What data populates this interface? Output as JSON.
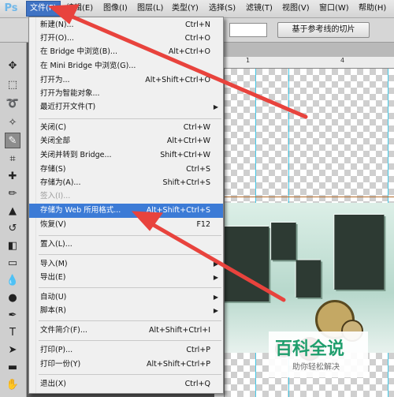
{
  "app": {
    "logo": "Ps"
  },
  "menubar": {
    "items": [
      {
        "label": "文件(F)"
      },
      {
        "label": "编辑(E)"
      },
      {
        "label": "图像(I)"
      },
      {
        "label": "图层(L)"
      },
      {
        "label": "类型(Y)"
      },
      {
        "label": "选择(S)"
      },
      {
        "label": "滤镜(T)"
      },
      {
        "label": "视图(V)"
      },
      {
        "label": "窗口(W)"
      },
      {
        "label": "帮助(H)"
      }
    ]
  },
  "options_bar": {
    "slice_button": "基于参考线的切片"
  },
  "ruler": {
    "ticks": [
      "1",
      "4"
    ]
  },
  "file_menu": {
    "items": [
      {
        "label": "新建(N)...",
        "shortcut": "Ctrl+N"
      },
      {
        "label": "打开(O)...",
        "shortcut": "Ctrl+O"
      },
      {
        "label": "在 Bridge 中浏览(B)...",
        "shortcut": "Alt+Ctrl+O"
      },
      {
        "label": "在 Mini Bridge 中浏览(G)...",
        "shortcut": ""
      },
      {
        "label": "打开为...",
        "shortcut": "Alt+Shift+Ctrl+O"
      },
      {
        "label": "打开为智能对象...",
        "shortcut": ""
      },
      {
        "label": "最近打开文件(T)",
        "shortcut": ""
      },
      {
        "label": "关闭(C)",
        "shortcut": "Ctrl+W"
      },
      {
        "label": "关闭全部",
        "shortcut": "Alt+Ctrl+W"
      },
      {
        "label": "关闭并转到 Bridge...",
        "shortcut": "Shift+Ctrl+W"
      },
      {
        "label": "存储(S)",
        "shortcut": "Ctrl+S"
      },
      {
        "label": "存储为(A)...",
        "shortcut": "Shift+Ctrl+S"
      },
      {
        "label": "签入(I)...",
        "shortcut": ""
      },
      {
        "label": "存储为 Web 所用格式...",
        "shortcut": "Alt+Shift+Ctrl+S"
      },
      {
        "label": "恢复(V)",
        "shortcut": "F12"
      },
      {
        "label": "置入(L)...",
        "shortcut": ""
      },
      {
        "label": "导入(M)",
        "shortcut": ""
      },
      {
        "label": "导出(E)",
        "shortcut": ""
      },
      {
        "label": "自动(U)",
        "shortcut": ""
      },
      {
        "label": "脚本(R)",
        "shortcut": ""
      },
      {
        "label": "文件简介(F)...",
        "shortcut": "Alt+Shift+Ctrl+I"
      },
      {
        "label": "打印(P)...",
        "shortcut": "Ctrl+P"
      },
      {
        "label": "打印一份(Y)",
        "shortcut": "Alt+Shift+Ctrl+P"
      },
      {
        "label": "退出(X)",
        "shortcut": "Ctrl+Q"
      }
    ]
  },
  "watermark": {
    "title": "百科全说",
    "subtitle": "助你轻松解决"
  },
  "colors": {
    "highlight": "#3c7bd6",
    "arrow": "#e8433d",
    "guide": "#45c8e6"
  }
}
